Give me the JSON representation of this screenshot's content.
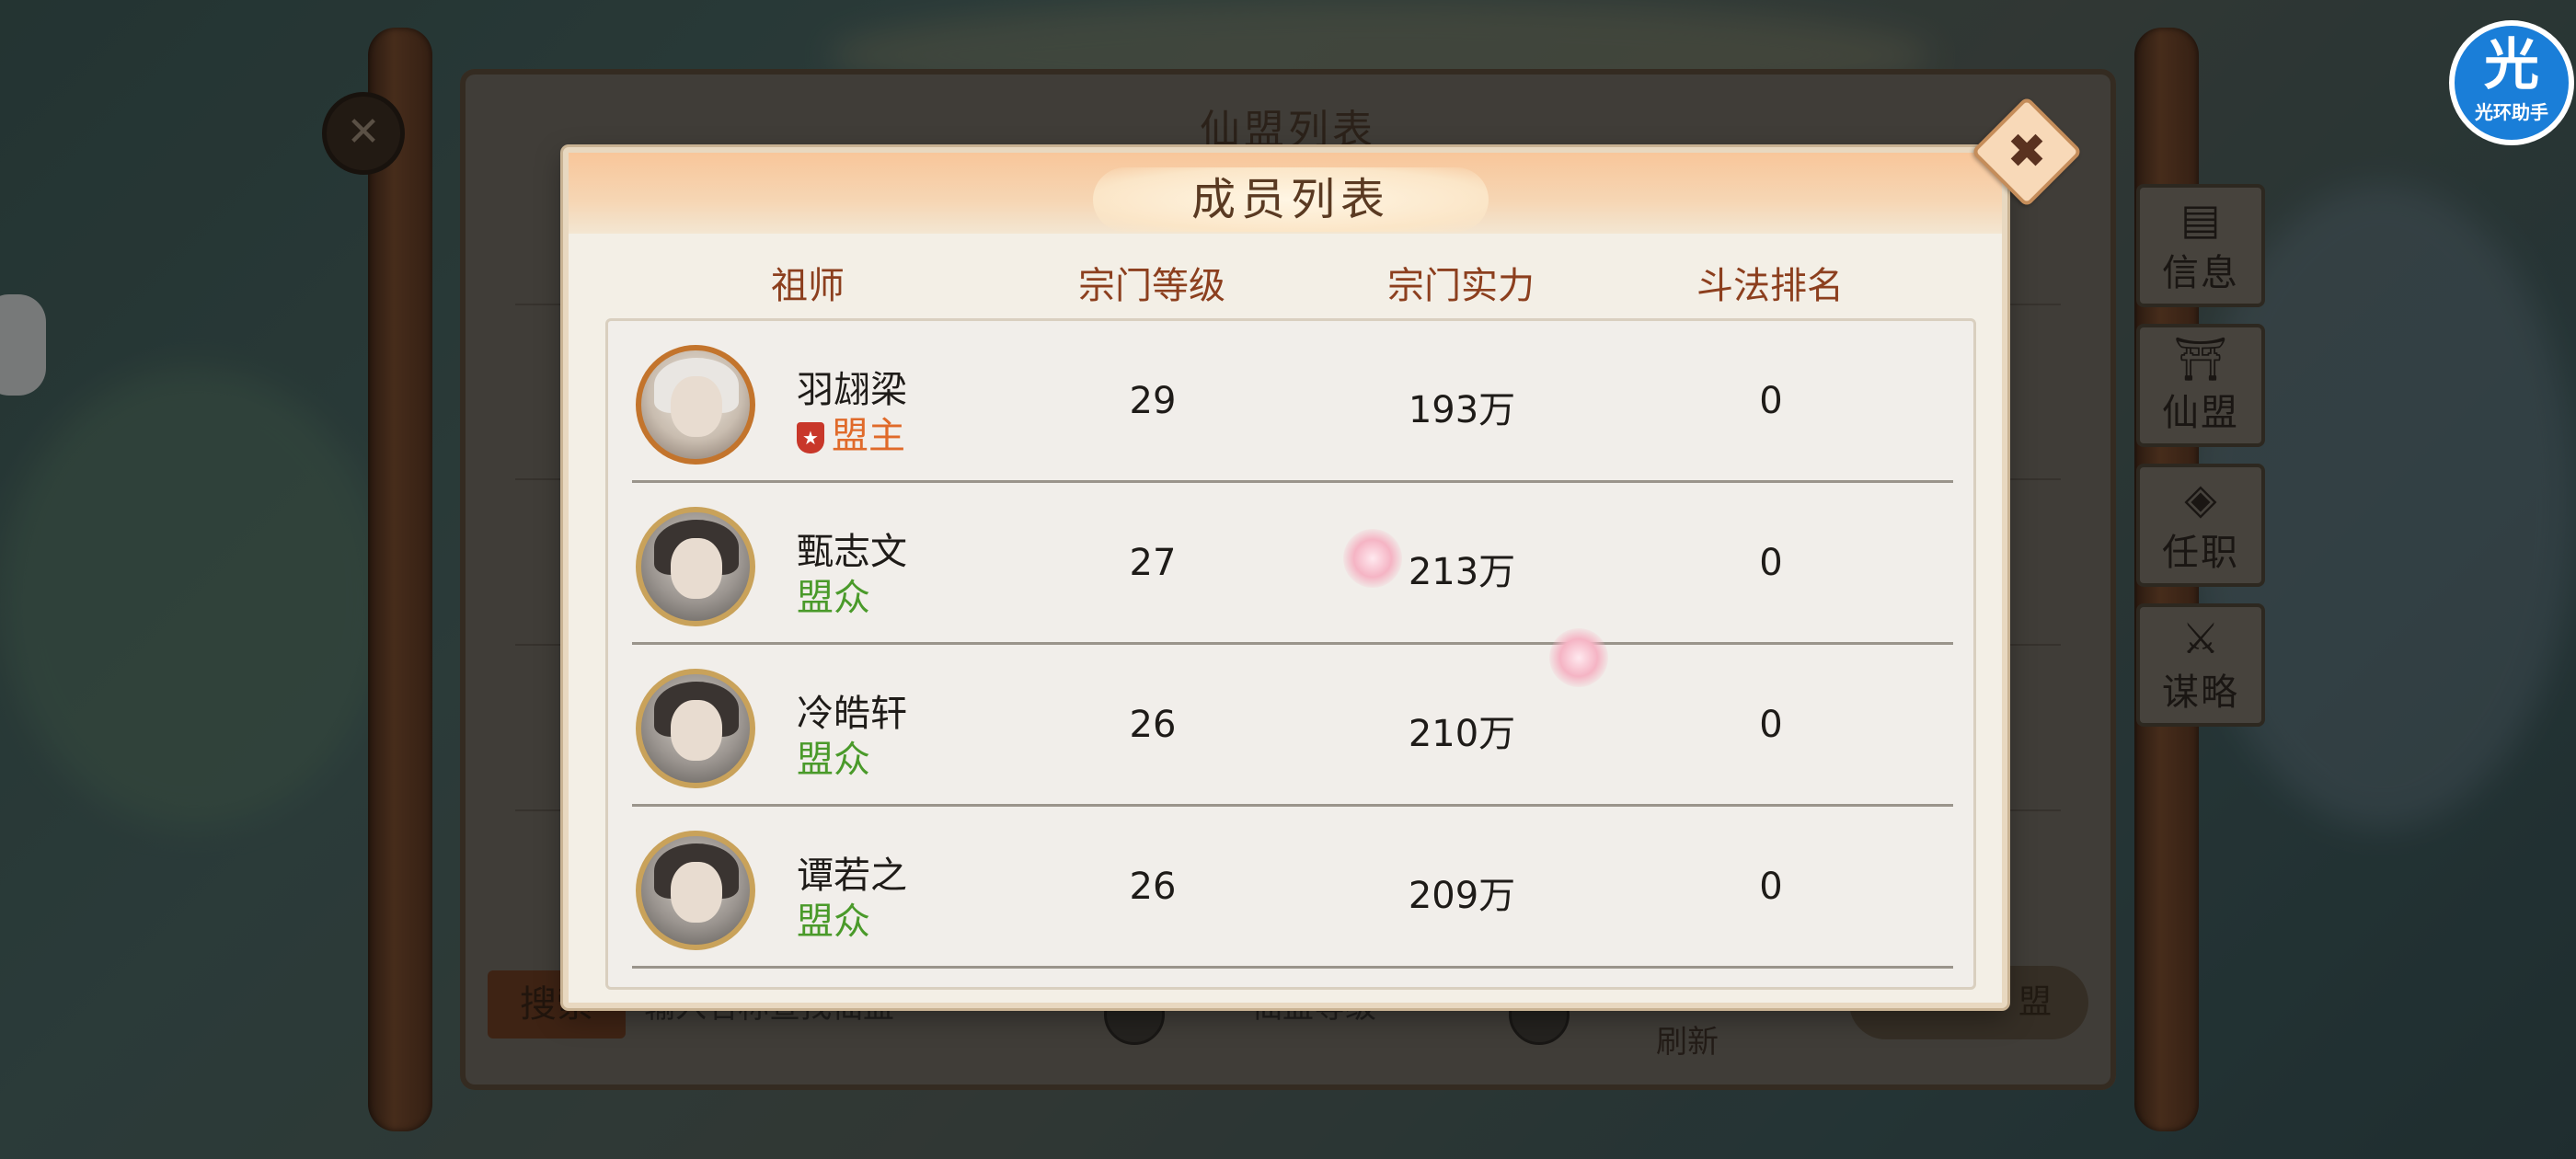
{
  "background": {
    "panel_title": "仙盟列表",
    "search_button": "搜索",
    "search_placeholder": "输入名称查找仙盟",
    "level_select": "仙盟等级",
    "refresh_label": "刷新",
    "create_label": "盟"
  },
  "side_tabs": [
    {
      "label": "信息",
      "icon": "scroll-icon"
    },
    {
      "label": "仙盟",
      "icon": "pagoda-icon"
    },
    {
      "label": "任职",
      "icon": "tag-icon"
    },
    {
      "label": "谋略",
      "icon": "sword-icon"
    }
  ],
  "assistant": {
    "char": "光",
    "text": "光环助手",
    "color": "#1a7ed8"
  },
  "modal": {
    "title": "成员列表",
    "close_symbol": "✖",
    "columns": [
      "祖师",
      "宗门等级",
      "宗门实力",
      "斗法排名"
    ],
    "members": [
      {
        "name": "羽翃梁",
        "rank": "盟主",
        "level": "29",
        "power": "193万",
        "ranking": "0"
      },
      {
        "name": "甄志文",
        "rank": "盟众",
        "level": "27",
        "power": "213万",
        "ranking": "0"
      },
      {
        "name": "冷皓轩",
        "rank": "盟众",
        "level": "26",
        "power": "210万",
        "ranking": "0"
      },
      {
        "name": "谭若之",
        "rank": "盟众",
        "level": "26",
        "power": "209万",
        "ranking": "0"
      }
    ]
  },
  "colors": {
    "leader_rank": "#e06a2a",
    "member_rank": "#4a9a2a",
    "column_header": "#8c3f1e"
  }
}
